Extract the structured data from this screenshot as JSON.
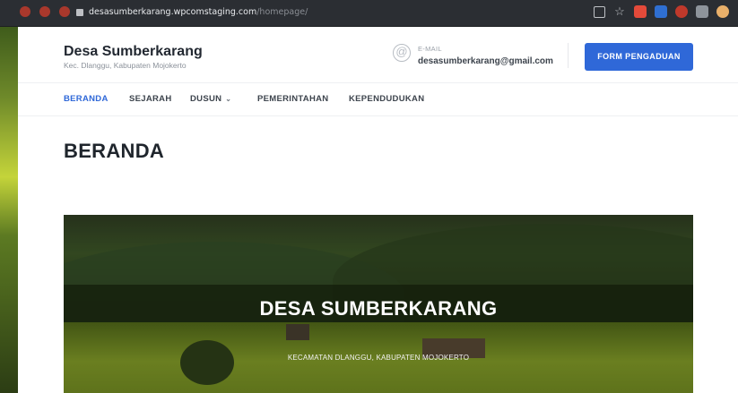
{
  "browser": {
    "url_host": "desasumberkarang.wpcomstaging.com",
    "url_path": "/homepage/"
  },
  "site": {
    "title": "Desa Sumberkarang",
    "subtitle": "Kec. Dlanggu, Kabupaten Mojokerto"
  },
  "contact": {
    "label": "E-MAIL",
    "email": "desasumberkarang@gmail.com",
    "icon": "at-sign-icon"
  },
  "header": {
    "cta_label": "FORM PENGADUAN",
    "cta_color": "#2f68d8"
  },
  "nav": {
    "items": [
      {
        "label": "BERANDA",
        "active": true
      },
      {
        "label": "SEJARAH",
        "active": false
      },
      {
        "label": "DUSUN",
        "active": false,
        "dropdown": true
      },
      {
        "label": "PEMERINTAHAN",
        "active": false
      },
      {
        "label": "KEPENDUDUKAN",
        "active": false
      }
    ],
    "active_color": "#2f68d8"
  },
  "main": {
    "heading": "BERANDA",
    "hero": {
      "title": "DESA SUMBERKARANG",
      "subtitle": "KECAMATAN DLANGGU, KABUPATEN MOJOKERTO"
    }
  }
}
